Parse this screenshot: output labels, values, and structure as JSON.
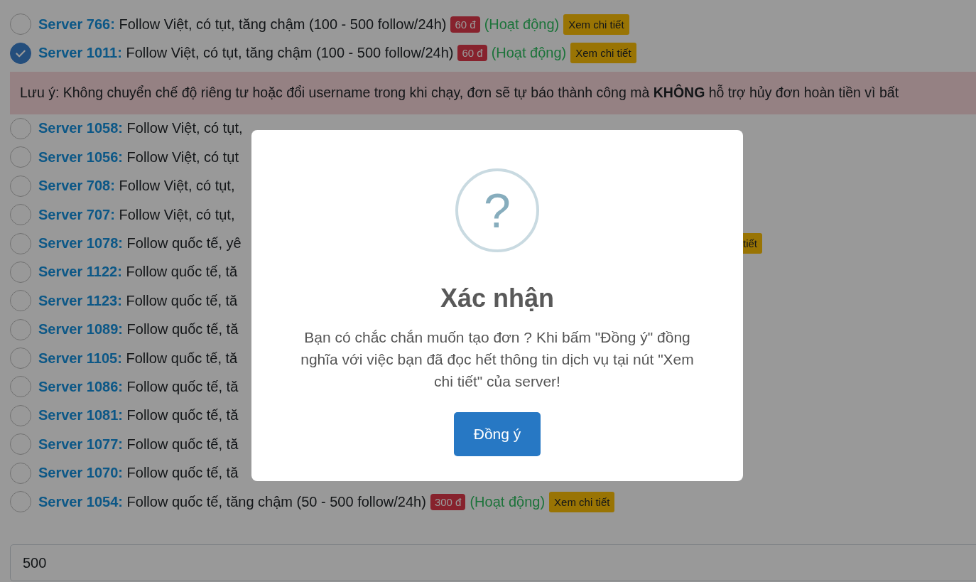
{
  "servers": [
    {
      "server": "Server 766:",
      "description": "Follow Việt, có tụt, tăng chậm (100 - 500 follow/24h)",
      "price": "60 đ",
      "status": "(Hoạt động)",
      "detail": "Xem chi tiết",
      "selected": false
    },
    {
      "server": "Server 1011:",
      "description": "Follow Việt, có tụt, tăng chậm (100 - 500 follow/24h)",
      "price": "60 đ",
      "status": "(Hoạt động)",
      "detail": "Xem chi tiết",
      "selected": true
    },
    {
      "kind": "notice",
      "text": "Lưu ý: Không chuyển chế độ riêng tư hoặc đổi username trong khi chạy, đơn sẽ tự báo thành công mà **KHÔNG** hỗ trợ hủy đơn hoàn tiền vì bất"
    },
    {
      "server": "Server 1058:",
      "description": "Follow Việt, có tụt,",
      "selected": false
    },
    {
      "server": "Server 1056:",
      "description": "Follow Việt, có tụt",
      "selected": false
    },
    {
      "server": "Server 708:",
      "description": "Follow Việt, có tụt,",
      "selected": false
    },
    {
      "server": "Server 707:",
      "description": "Follow Việt, có tụt,",
      "selected": false
    },
    {
      "server": "Server 1078:",
      "description": "Follow quốc tế, yê",
      "tail": "tiết",
      "selected": false
    },
    {
      "server": "Server 1122:",
      "description": "Follow quốc tế, tă",
      "selected": false
    },
    {
      "server": "Server 1123:",
      "description": "Follow quốc tế, tă",
      "selected": false
    },
    {
      "server": "Server 1089:",
      "description": "Follow quốc tế, tă",
      "selected": false
    },
    {
      "server": "Server 1105:",
      "description": "Follow quốc tế, tă",
      "selected": false
    },
    {
      "server": "Server 1086:",
      "description": "Follow quốc tế, tă",
      "selected": false
    },
    {
      "server": "Server 1081:",
      "description": "Follow quốc tế, tă",
      "selected": false
    },
    {
      "server": "Server 1077:",
      "description": "Follow quốc tế, tă",
      "selected": false
    },
    {
      "server": "Server 1070:",
      "description": "Follow quốc tế, tă",
      "selected": false
    },
    {
      "server": "Server 1054:",
      "description": "Follow quốc tế, tăng chậm (50 - 500 follow/24h)",
      "price": "300 đ",
      "status": "(Hoạt động)",
      "detail": "Xem chi tiết",
      "selected": false
    }
  ],
  "quantity_input": {
    "value": "500"
  },
  "dialog": {
    "icon": "?",
    "title": "Xác nhận",
    "message": "Bạn có chắc chắn muốn tạo đơn ? Khi bấm \"Đồng ý\" đồng nghĩa với việc bạn đã đọc hết thông tin dịch vụ tại nút \"Xem chi tiết\" của server!",
    "confirm_button": "Đồng ý"
  }
}
